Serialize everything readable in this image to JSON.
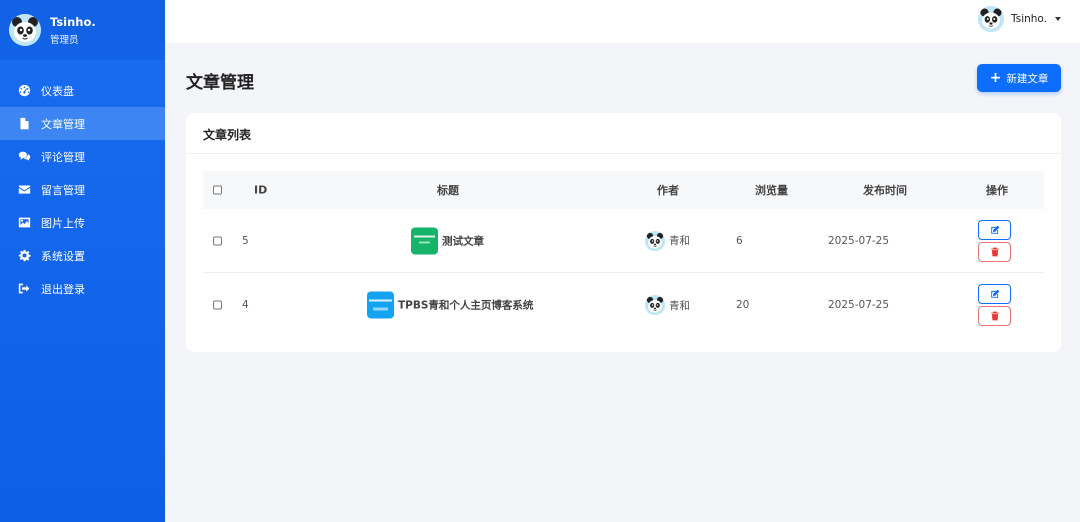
{
  "profile": {
    "name": "Tsinho.",
    "role": "管理员"
  },
  "topbar": {
    "user_name": "Tsinho."
  },
  "sidebar": {
    "items": [
      {
        "label": "仪表盘",
        "icon": "dashboard-icon",
        "active": false
      },
      {
        "label": "文章管理",
        "icon": "file-icon",
        "active": true
      },
      {
        "label": "评论管理",
        "icon": "comments-icon",
        "active": false
      },
      {
        "label": "留言管理",
        "icon": "envelope-icon",
        "active": false
      },
      {
        "label": "图片上传",
        "icon": "image-icon",
        "active": false
      },
      {
        "label": "系统设置",
        "icon": "gear-icon",
        "active": false
      },
      {
        "label": "退出登录",
        "icon": "sign-out-icon",
        "active": false
      }
    ]
  },
  "page": {
    "title": "文章管理",
    "new_button": "新建文章"
  },
  "card": {
    "title": "文章列表"
  },
  "table": {
    "headers": {
      "id": "ID",
      "title": "标题",
      "author": "作者",
      "views": "浏览量",
      "published": "发布时间",
      "actions": "操作"
    },
    "rows": [
      {
        "id": "5",
        "title": "测试文章",
        "author": "青和",
        "views": "6",
        "date": "2025-07-25",
        "thumb_color": "#16b36a"
      },
      {
        "id": "4",
        "title": "TPBS青和个人主页博客系统",
        "author": "青和",
        "views": "20",
        "date": "2025-07-25",
        "thumb_color": "#14a3f0"
      }
    ]
  },
  "colors": {
    "primary": "#0d6efd",
    "sidebar": "#1262e6",
    "danger": "#e53935"
  }
}
